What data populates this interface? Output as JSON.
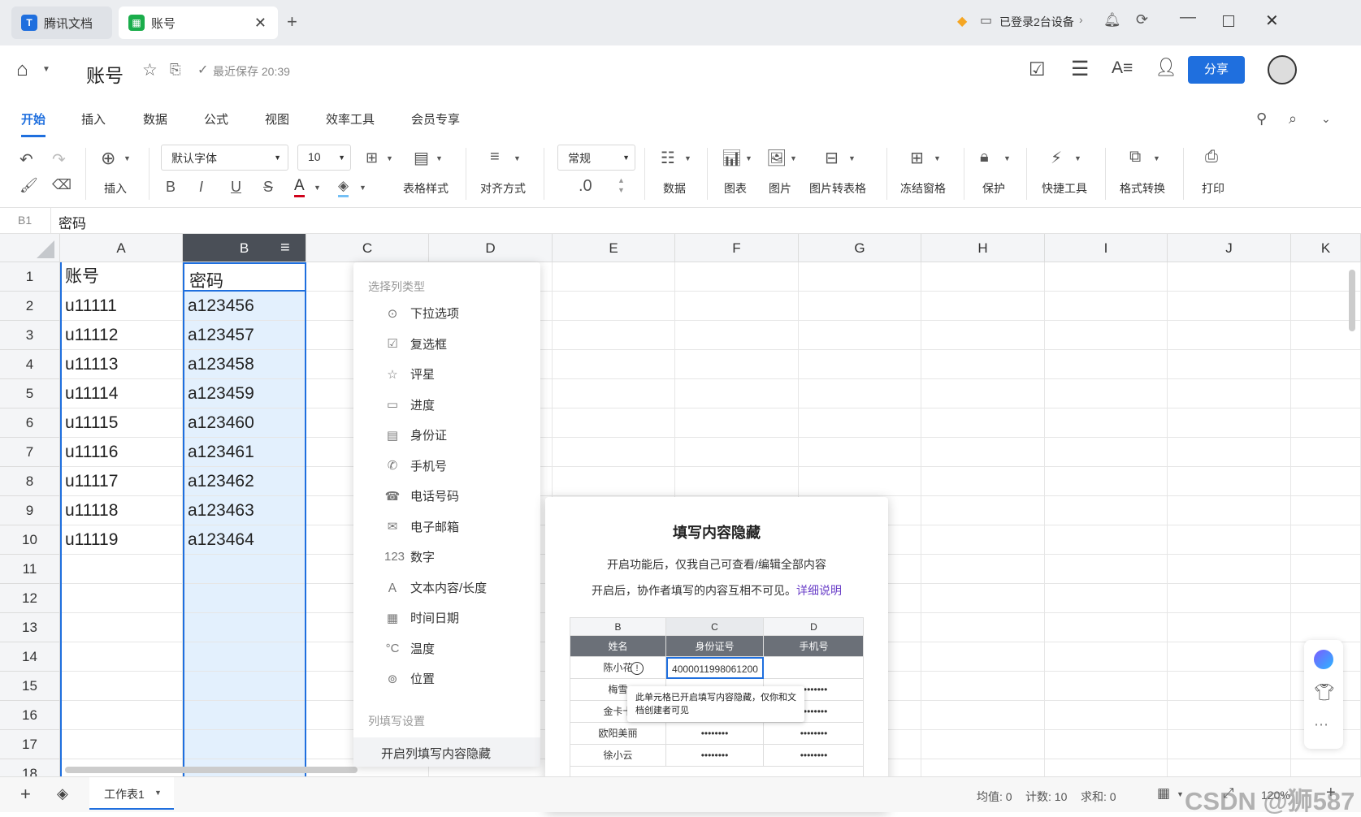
{
  "titlebar": {
    "tab1": "腾讯文档",
    "tab2": "账号",
    "devices": "已登录2台设备",
    "devices_chevron": "›"
  },
  "header": {
    "title": "账号",
    "save_status": "最近保存 20:39",
    "share": "分享"
  },
  "menus": [
    "开始",
    "插入",
    "数据",
    "公式",
    "视图",
    "效率工具",
    "会员专享"
  ],
  "toolbar": {
    "insert": "插入",
    "font": "默认字体",
    "size": "10",
    "bold": "B",
    "italic": "I",
    "underline": "U",
    "strike": "S",
    "fontcolor": "A",
    "tablestyle": "表格样式",
    "align": "对齐方式",
    "numfmt": "常规",
    "decimal": ".0",
    "data": "数据",
    "chart": "图表",
    "image": "图片",
    "img2table": "图片转表格",
    "freeze": "冻结窗格",
    "protect": "保护",
    "quick": "快捷工具",
    "format": "格式转换",
    "print": "打印",
    "accent": "#1f6fde"
  },
  "formula": {
    "ref": "B1",
    "value": "密码"
  },
  "columns": [
    "A",
    "B",
    "C",
    "D",
    "E",
    "F",
    "G",
    "H",
    "I",
    "J",
    "K"
  ],
  "rows": [
    "1",
    "2",
    "3",
    "4",
    "5",
    "6",
    "7",
    "8",
    "9",
    "10",
    "11",
    "12",
    "13",
    "14",
    "15",
    "16",
    "17",
    "18"
  ],
  "colA": [
    "账号",
    "u11111",
    "u11112",
    "u11113",
    "u11114",
    "u11115",
    "u11116",
    "u11117",
    "u11118",
    "u11119"
  ],
  "colB": [
    "密码",
    "a123456",
    "a123457",
    "a123458",
    "a123459",
    "a123460",
    "a123461",
    "a123462",
    "a123463",
    "a123464"
  ],
  "popup": {
    "header1": "选择列类型",
    "items": [
      "下拉选项",
      "复选框",
      "评星",
      "进度",
      "身份证",
      "手机号",
      "电话号码",
      "电子邮箱",
      "数字",
      "文本内容/长度",
      "时间日期",
      "温度",
      "位置"
    ],
    "header2": "列填写设置",
    "action": "开启列填写内容隐藏"
  },
  "tooltip": {
    "title": "填写内容隐藏",
    "line1": "开启功能后，仅我自己可查看/编辑全部内容",
    "line2": "开启后，协作者填写的内容互相不可见。",
    "link": "详细说明",
    "mini": {
      "cols": [
        "B",
        "C",
        "D"
      ],
      "heads": [
        "姓名",
        "身份证号",
        "手机号"
      ],
      "rows": [
        [
          "陈小花",
          "4000011998061200",
          ""
        ],
        [
          "梅雪",
          "",
          "••••••••"
        ],
        [
          "金卡卡",
          "",
          "••••••••"
        ],
        [
          "欧阳美丽",
          "••••••••",
          "••••••••"
        ],
        [
          "徐小云",
          "••••••••",
          "••••••••"
        ]
      ],
      "tip": "此单元格已开启填写内容隐藏，仅你和文档创建者可见",
      "warn": "!"
    }
  },
  "statusbar": {
    "sheet": "工作表1",
    "avg": "均值: 0",
    "count": "计数: 10",
    "sum": "求和: 0",
    "zoom": "120%"
  },
  "watermark": "CSDN @狮587"
}
